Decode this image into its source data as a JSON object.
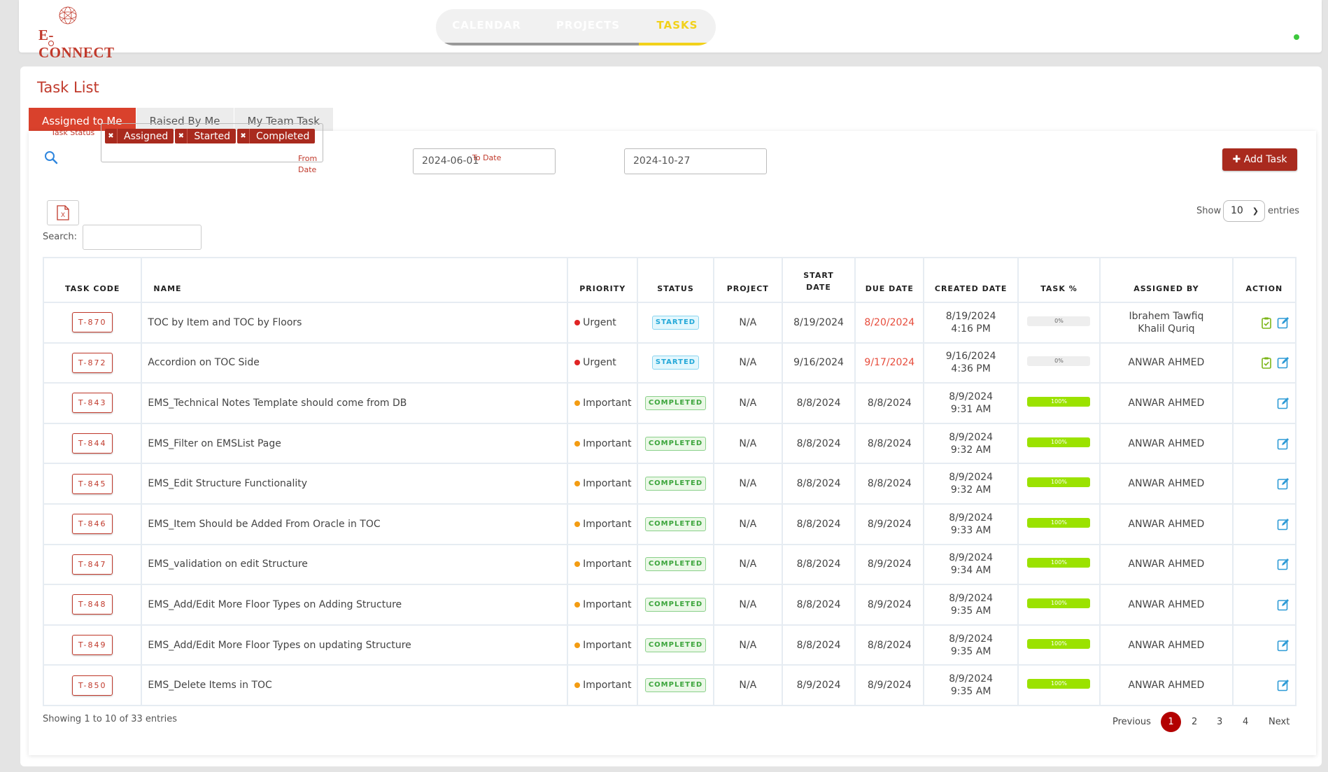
{
  "brand": {
    "logo_text": "E-CONNECT",
    "accent": "#c0392b"
  },
  "nav": {
    "tabs": [
      "CALENDAR",
      "PROJECTS",
      "TASKS"
    ],
    "active": "TASKS"
  },
  "page": {
    "title": "Task List",
    "subtabs": [
      "Assigned to Me",
      "Raised By Me",
      "My Team Task"
    ],
    "active_subtab": "Assigned to Me"
  },
  "filters": {
    "task_status_label": "Task Status",
    "status_tags": [
      "Assigned",
      "Started",
      "Completed"
    ],
    "from_date_label": "From Date",
    "from_date": "2024-06-01",
    "to_date_label": "To Date",
    "to_date": "2024-10-27",
    "add_task_label": "Add Task"
  },
  "table_controls": {
    "search_label": "Search:",
    "show_label": "Show",
    "show_value": "10",
    "entries_label": "entries"
  },
  "table": {
    "headers": [
      "TASK CODE",
      "NAME",
      "PRIORITY",
      "STATUS",
      "PROJECT",
      "START DATE",
      "DUE DATE",
      "CREATED DATE",
      "TASK %",
      "ASSIGNED BY",
      "ACTION"
    ],
    "rows": [
      {
        "code": "T-870",
        "name": "TOC by Item and TOC by Floors",
        "priority": "Urgent",
        "status": "STARTED",
        "project": "N/A",
        "start": "8/19/2024",
        "due": "8/20/2024",
        "due_overdue": true,
        "created": "8/19/2024 4:16 PM",
        "pct": "0%",
        "pct_value": 0,
        "assigned_by": "Ibrahem Tawfiq Khalil Quriq",
        "has_check": true
      },
      {
        "code": "T-872",
        "name": "Accordion on TOC Side",
        "priority": "Urgent",
        "status": "STARTED",
        "project": "N/A",
        "start": "9/16/2024",
        "due": "9/17/2024",
        "due_overdue": true,
        "created": "9/16/2024 4:36 PM",
        "pct": "0%",
        "pct_value": 0,
        "assigned_by": "ANWAR AHMED",
        "has_check": true
      },
      {
        "code": "T-843",
        "name": "EMS_Technical Notes Template should come from DB",
        "priority": "Important",
        "status": "COMPLETED",
        "project": "N/A",
        "start": "8/8/2024",
        "due": "8/8/2024",
        "due_overdue": false,
        "created": "8/9/2024 9:31 AM",
        "pct": "100%",
        "pct_value": 100,
        "assigned_by": "ANWAR AHMED",
        "has_check": false
      },
      {
        "code": "T-844",
        "name": "EMS_Filter on EMSList Page",
        "priority": "Important",
        "status": "COMPLETED",
        "project": "N/A",
        "start": "8/8/2024",
        "due": "8/8/2024",
        "due_overdue": false,
        "created": "8/9/2024 9:32 AM",
        "pct": "100%",
        "pct_value": 100,
        "assigned_by": "ANWAR AHMED",
        "has_check": false
      },
      {
        "code": "T-845",
        "name": "EMS_Edit Structure Functionality",
        "priority": "Important",
        "status": "COMPLETED",
        "project": "N/A",
        "start": "8/8/2024",
        "due": "8/8/2024",
        "due_overdue": false,
        "created": "8/9/2024 9:32 AM",
        "pct": "100%",
        "pct_value": 100,
        "assigned_by": "ANWAR AHMED",
        "has_check": false
      },
      {
        "code": "T-846",
        "name": "EMS_Item Should be Added From Oracle in TOC",
        "priority": "Important",
        "status": "COMPLETED",
        "project": "N/A",
        "start": "8/8/2024",
        "due": "8/9/2024",
        "due_overdue": false,
        "created": "8/9/2024 9:33 AM",
        "pct": "100%",
        "pct_value": 100,
        "assigned_by": "ANWAR AHMED",
        "has_check": false
      },
      {
        "code": "T-847",
        "name": "EMS_validation on edit Structure",
        "priority": "Important",
        "status": "COMPLETED",
        "project": "N/A",
        "start": "8/8/2024",
        "due": "8/9/2024",
        "due_overdue": false,
        "created": "8/9/2024 9:34 AM",
        "pct": "100%",
        "pct_value": 100,
        "assigned_by": "ANWAR AHMED",
        "has_check": false
      },
      {
        "code": "T-848",
        "name": "EMS_Add/Edit More Floor Types on Adding Structure",
        "priority": "Important",
        "status": "COMPLETED",
        "project": "N/A",
        "start": "8/8/2024",
        "due": "8/9/2024",
        "due_overdue": false,
        "created": "8/9/2024 9:35 AM",
        "pct": "100%",
        "pct_value": 100,
        "assigned_by": "ANWAR AHMED",
        "has_check": false
      },
      {
        "code": "T-849",
        "name": "EMS_Add/Edit More Floor Types on updating Structure",
        "priority": "Important",
        "status": "COMPLETED",
        "project": "N/A",
        "start": "8/8/2024",
        "due": "8/8/2024",
        "due_overdue": false,
        "created": "8/9/2024 9:35 AM",
        "pct": "100%",
        "pct_value": 100,
        "assigned_by": "ANWAR AHMED",
        "has_check": false
      },
      {
        "code": "T-850",
        "name": "EMS_Delete Items in TOC",
        "priority": "Important",
        "status": "COMPLETED",
        "project": "N/A",
        "start": "8/9/2024",
        "due": "8/9/2024",
        "due_overdue": false,
        "created": "8/9/2024 9:35 AM",
        "pct": "100%",
        "pct_value": 100,
        "assigned_by": "ANWAR AHMED",
        "has_check": false
      }
    ]
  },
  "footer": {
    "showing": "Showing 1 to 10 of 33 entries",
    "previous": "Previous",
    "pages": [
      "1",
      "2",
      "3",
      "4"
    ],
    "active_page": "1",
    "next": "Next"
  },
  "colors": {
    "urgent": "#e02424",
    "important": "#f39c12",
    "overdue": "#e74c3c",
    "progress": "#9be200",
    "online": "#3cc83c"
  }
}
